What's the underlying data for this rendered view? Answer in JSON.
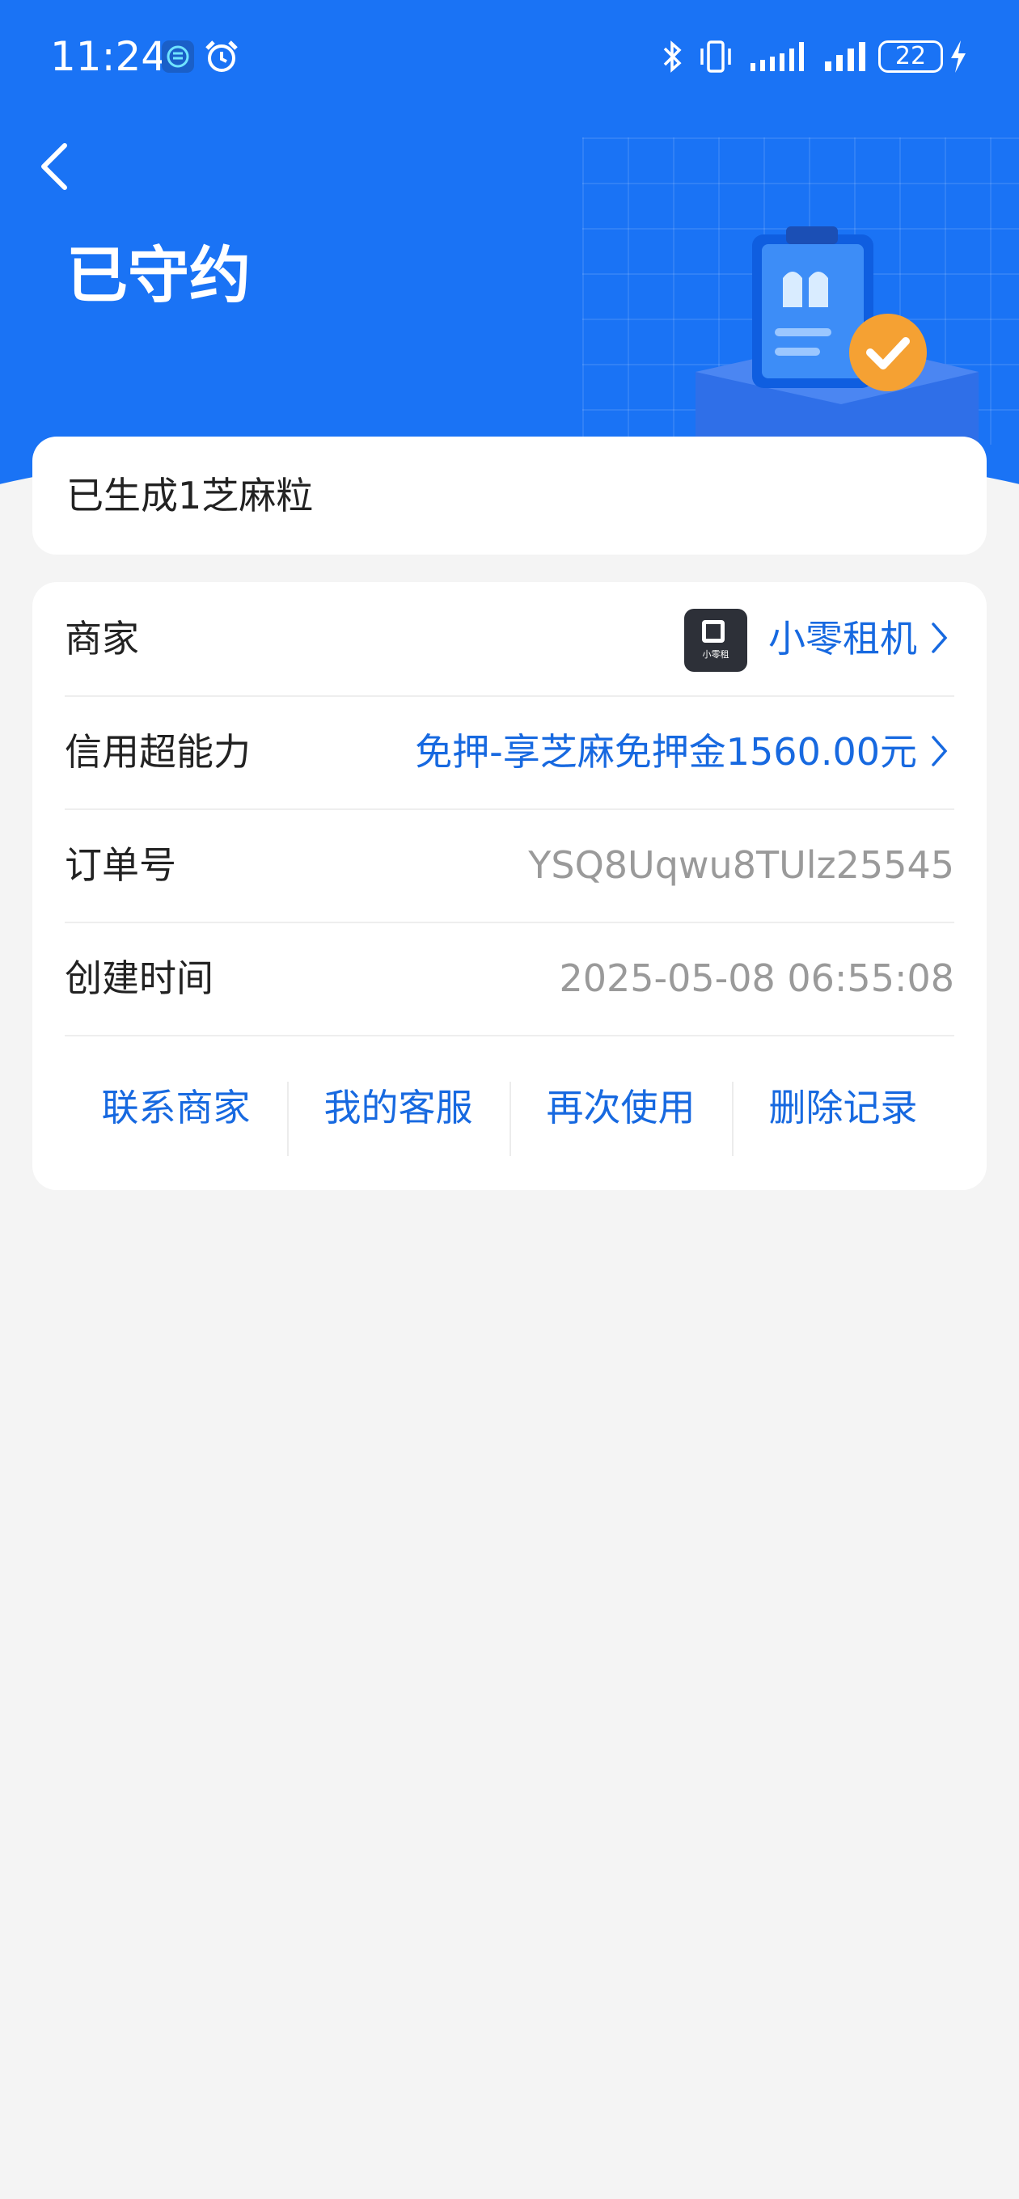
{
  "status_bar": {
    "time": "11:24",
    "battery": "22",
    "icons": [
      "app-notification-icon",
      "alarm-icon",
      "bluetooth-icon",
      "vibrate-icon",
      "signal-icon",
      "signal-icon",
      "battery-icon",
      "charging-icon"
    ]
  },
  "header": {
    "title": "已守约"
  },
  "summary": {
    "text": "已生成1芝麻粒"
  },
  "details": {
    "merchant_label": "商家",
    "merchant_name": "小零租机",
    "merchant_logo_text": "小零租",
    "credit_label": "信用超能力",
    "credit_value": "免押-享芝麻免押金1560.00元",
    "order_label": "订单号",
    "order_value": "YSQ8Uqwu8TUlz25545",
    "created_label": "创建时间",
    "created_value": "2025-05-08 06:55:08"
  },
  "actions": {
    "contact_merchant": "联系商家",
    "my_service": "我的客服",
    "use_again": "再次使用",
    "delete_record": "删除记录"
  },
  "colors": {
    "header_blue": "#1a73f5",
    "link_blue": "#1769e0",
    "badge_orange": "#f5a133"
  }
}
